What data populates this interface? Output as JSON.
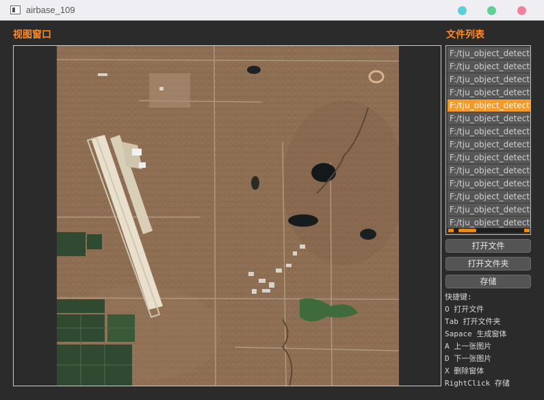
{
  "window": {
    "title": "airbase_109"
  },
  "view": {
    "title": "视图窗口"
  },
  "files": {
    "title": "文件列表",
    "items": [
      "F:/tju_object_detection",
      "F:/tju_object_detection",
      "F:/tju_object_detection",
      "F:/tju_object_detection",
      "F:/tju_object_detection",
      "F:/tju_object_detection",
      "F:/tju_object_detection",
      "F:/tju_object_detection",
      "F:/tju_object_detection",
      "F:/tju_object_detection",
      "F:/tju_object_detection",
      "F:/tju_object_detection",
      "F:/tju_object_detection",
      "F:/tju_object_detection"
    ],
    "selected_index": 4
  },
  "buttons": {
    "open_file": "打开文件",
    "open_folder": "打开文件夹",
    "save": "存储"
  },
  "shortcuts": {
    "heading": "快捷键:",
    "lines": [
      "O 打开文件",
      "Tab 打开文件夹",
      "Sapace 生成窗体",
      "A 上一张图片",
      "D 下一张图片",
      "X 删除窗体",
      "RightClick 存储"
    ]
  },
  "colors": {
    "accent": "#ff8a2a",
    "selected": "#f39a2a",
    "background": "#2b2b2b",
    "win_min": "#5ccfd9",
    "win_max": "#5fcf93",
    "win_close": "#f0819e"
  }
}
